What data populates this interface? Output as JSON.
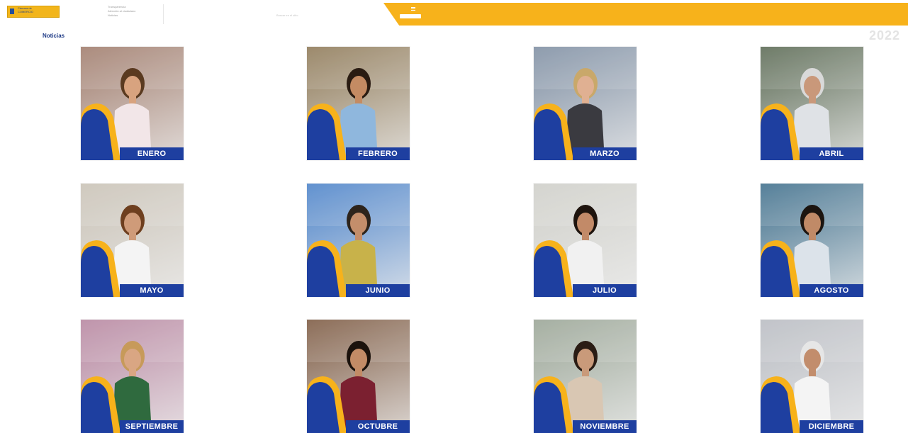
{
  "header": {
    "logo_text_line1": "Cámara de",
    "logo_text_line2": "COMERCIO",
    "link_1": "Transparencia",
    "link_2": "Atención al ciudadano",
    "link_3": "Noticias",
    "search_placeholder": "Buscar en el sitio"
  },
  "page": {
    "section_title": "Noticias",
    "year": "2022"
  },
  "months": [
    {
      "label": "ENERO",
      "bg": "#a07c6c",
      "shirt": "#f2e6e8",
      "hair": "#5a3a20",
      "skin": "#d8a37f"
    },
    {
      "label": "FEBRERO",
      "bg": "#8f7a58",
      "shirt": "#8fb7dd",
      "hair": "#2a1c12",
      "skin": "#c48b63"
    },
    {
      "label": "MARZO",
      "bg": "#7f8fa3",
      "shirt": "#3a3a40",
      "hair": "#c9a86a",
      "skin": "#e0b092"
    },
    {
      "label": "ABRIL",
      "bg": "#5b6a54",
      "shirt": "#dfe2e6",
      "hair": "#d9d9d9",
      "skin": "#c9987a"
    },
    {
      "label": "MAYO",
      "bg": "#c9c2b6",
      "shirt": "#f4f4f4",
      "hair": "#6e3f1f",
      "skin": "#cf9b79"
    },
    {
      "label": "JUNIO",
      "bg": "#4c83c9",
      "shirt": "#c8b24a",
      "hair": "#2d241c",
      "skin": "#c48e6b"
    },
    {
      "label": "JULIO",
      "bg": "#cfcfc9",
      "shirt": "#f1f1f1",
      "hair": "#1e140e",
      "skin": "#c28a68"
    },
    {
      "label": "AGOSTO",
      "bg": "#3f6f8c",
      "shirt": "#dce3ea",
      "hair": "#1c1510",
      "skin": "#c08a67"
    },
    {
      "label": "SEPTIEMBRE",
      "bg": "#b786a0",
      "shirt": "#2f6a3e",
      "hair": "#c79a5a",
      "skin": "#d9a683"
    },
    {
      "label": "OCTUBRE",
      "bg": "#7d5a42",
      "shirt": "#7b2030",
      "hair": "#1b120c",
      "skin": "#c28b66"
    },
    {
      "label": "NOVIEMBRE",
      "bg": "#9aa596",
      "shirt": "#d9c7b3",
      "hair": "#2a1c14",
      "skin": "#c99a7a"
    },
    {
      "label": "DICIEMBRE",
      "bg": "#b9bcc2",
      "shirt": "#f4f4f4",
      "hair": "#e6e6e6",
      "skin": "#c28d6c"
    }
  ],
  "colors": {
    "brand_yellow": "#f7b21b",
    "brand_blue": "#1e3fa0",
    "title_blue": "#1e3a86"
  }
}
